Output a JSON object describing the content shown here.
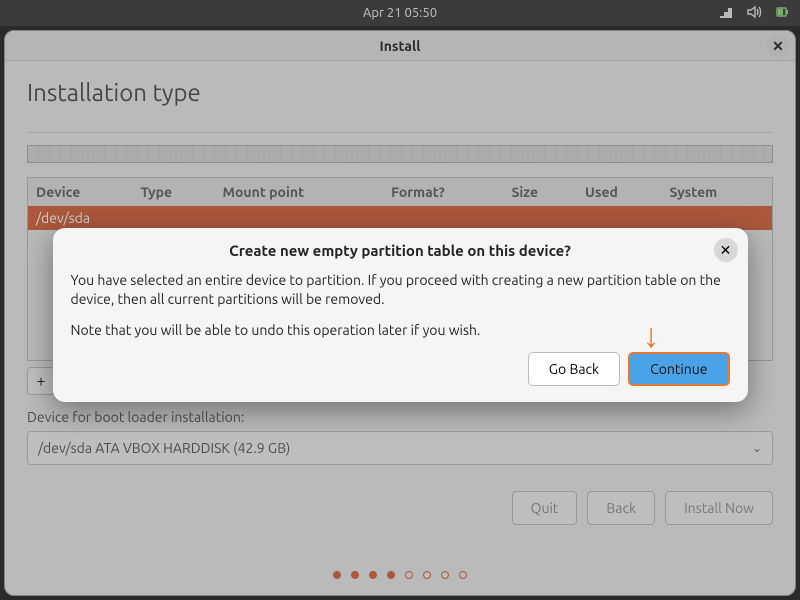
{
  "topbar": {
    "clock": "Apr 21  05:50"
  },
  "window": {
    "title": "Install"
  },
  "page": {
    "heading": "Installation type",
    "table": {
      "headers": [
        "Device",
        "Type",
        "Mount point",
        "Format?",
        "Size",
        "Used",
        "System"
      ],
      "rows": [
        {
          "device": "/dev/sda",
          "selected": true
        }
      ]
    },
    "add_btn": "+",
    "boot_label": "Device for boot loader installation:",
    "boot_value": "/dev/sda  ATA VBOX HARDDISK (42.9 GB)",
    "footer": {
      "quit": "Quit",
      "back": "Back",
      "install": "Install Now"
    }
  },
  "dialog": {
    "title": "Create new empty partition table on this device?",
    "body1": "You have selected an entire device to partition. If you proceed with creating a new partition table on the device, then all current partitions will be removed.",
    "body2": "Note that you will be able to undo this operation later if you wish.",
    "go_back": "Go Back",
    "continue": "Continue"
  }
}
